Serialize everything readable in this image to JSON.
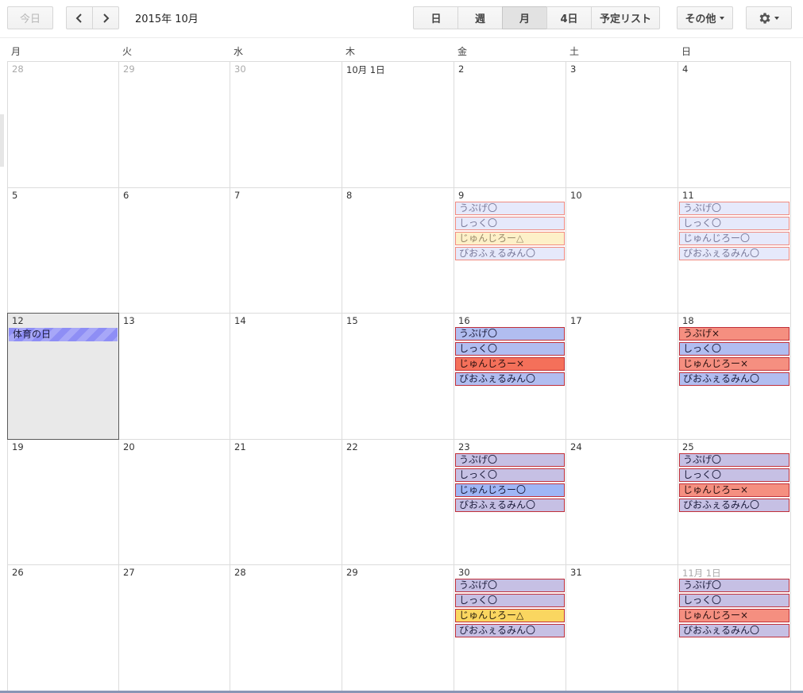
{
  "toolbar": {
    "today": "今日",
    "title": "2015年 10月",
    "views": [
      {
        "label": "日",
        "active": false
      },
      {
        "label": "週",
        "active": false
      },
      {
        "label": "月",
        "active": true
      },
      {
        "label": "4日",
        "active": false
      },
      {
        "label": "予定リスト",
        "active": false
      }
    ],
    "more": "その他"
  },
  "weekdays": [
    "月",
    "火",
    "水",
    "木",
    "金",
    "土",
    "日"
  ],
  "weeks": [
    [
      {
        "label": "28",
        "other": true,
        "events": []
      },
      {
        "label": "29",
        "other": true,
        "events": []
      },
      {
        "label": "30",
        "other": true,
        "events": []
      },
      {
        "label": "10月 1日",
        "other": false,
        "events": []
      },
      {
        "label": "2",
        "other": false,
        "events": []
      },
      {
        "label": "3",
        "other": false,
        "events": []
      },
      {
        "label": "4",
        "other": false,
        "events": []
      }
    ],
    [
      {
        "label": "5",
        "events": []
      },
      {
        "label": "6",
        "events": []
      },
      {
        "label": "7",
        "events": []
      },
      {
        "label": "8",
        "events": []
      },
      {
        "label": "9",
        "events": [
          {
            "title": "うぶげ〇",
            "style": "past"
          },
          {
            "title": "しっく〇",
            "style": "past"
          },
          {
            "title": "じゅんじろー△",
            "style": "past-yellow"
          },
          {
            "title": "びおふぇるみん〇",
            "style": "past"
          }
        ]
      },
      {
        "label": "10",
        "events": []
      },
      {
        "label": "11",
        "events": [
          {
            "title": "うぶげ〇",
            "style": "past"
          },
          {
            "title": "しっく〇",
            "style": "past"
          },
          {
            "title": "じゅんじろー〇",
            "style": "past"
          },
          {
            "title": "びおふぇるみん〇",
            "style": "past"
          }
        ]
      }
    ],
    [
      {
        "label": "12",
        "today": true,
        "allday": "体育の日",
        "events": []
      },
      {
        "label": "13",
        "events": []
      },
      {
        "label": "14",
        "events": []
      },
      {
        "label": "15",
        "events": []
      },
      {
        "label": "16",
        "events": [
          {
            "title": "うぶげ〇",
            "style": "blue"
          },
          {
            "title": "しっく〇",
            "style": "blue"
          },
          {
            "title": "じゅんじろー×",
            "style": "red-strong"
          },
          {
            "title": "びおふぇるみん〇",
            "style": "blue"
          }
        ]
      },
      {
        "label": "17",
        "events": []
      },
      {
        "label": "18",
        "events": [
          {
            "title": "うぶげ×",
            "style": "salmon"
          },
          {
            "title": "しっく〇",
            "style": "blue"
          },
          {
            "title": "じゅんじろー×",
            "style": "salmon"
          },
          {
            "title": "びおふぇるみん〇",
            "style": "blue"
          }
        ]
      }
    ],
    [
      {
        "label": "19",
        "events": []
      },
      {
        "label": "20",
        "events": []
      },
      {
        "label": "21",
        "events": []
      },
      {
        "label": "22",
        "events": []
      },
      {
        "label": "23",
        "events": [
          {
            "title": "うぶげ〇",
            "style": "lavender"
          },
          {
            "title": "しっく〇",
            "style": "lavender"
          },
          {
            "title": "じゅんじろー〇",
            "style": "cornflower"
          },
          {
            "title": "びおふぇるみん〇",
            "style": "lavender"
          }
        ]
      },
      {
        "label": "24",
        "events": []
      },
      {
        "label": "25",
        "events": [
          {
            "title": "うぶげ〇",
            "style": "lavender"
          },
          {
            "title": "しっく〇",
            "style": "lavender"
          },
          {
            "title": "じゅんじろー×",
            "style": "salmon"
          },
          {
            "title": "びおふぇるみん〇",
            "style": "lavender"
          }
        ]
      }
    ],
    [
      {
        "label": "26",
        "events": []
      },
      {
        "label": "27",
        "events": []
      },
      {
        "label": "28",
        "events": []
      },
      {
        "label": "29",
        "events": []
      },
      {
        "label": "30",
        "events": [
          {
            "title": "うぶげ〇",
            "style": "lavender"
          },
          {
            "title": "しっく〇",
            "style": "lavender"
          },
          {
            "title": "じゅんじろー△",
            "style": "yellow"
          },
          {
            "title": "びおふぇるみん〇",
            "style": "lavender"
          }
        ]
      },
      {
        "label": "31",
        "events": []
      },
      {
        "label": "11月 1日",
        "other": true,
        "events": [
          {
            "title": "うぶげ〇",
            "style": "lavender"
          },
          {
            "title": "しっく〇",
            "style": "lavender"
          },
          {
            "title": "じゅんじろー×",
            "style": "salmon"
          },
          {
            "title": "びおふぇるみん〇",
            "style": "lavender"
          }
        ]
      }
    ]
  ],
  "event_styles": {
    "past": {
      "bg": "#e6e9fb",
      "border": "#f08a80",
      "color": "#7a7a9a"
    },
    "past-yellow": {
      "bg": "#fdf0c8",
      "border": "#f08a80",
      "color": "#9a8a6a"
    },
    "blue": {
      "bg": "#b1bdf0",
      "border": "#c0303a",
      "color": "#1b1b3a"
    },
    "red-strong": {
      "bg": "#f4705a",
      "border": "#c0303a",
      "color": "#2a1010"
    },
    "salmon": {
      "bg": "#f58f80",
      "border": "#c0303a",
      "color": "#2a1010"
    },
    "lavender": {
      "bg": "#c6c0e4",
      "border": "#c0303a",
      "color": "#1b1b3a"
    },
    "cornflower": {
      "bg": "#9fb6f5",
      "border": "#c0303a",
      "color": "#1b1b3a"
    },
    "yellow": {
      "bg": "#fad660",
      "border": "#c0303a",
      "color": "#2a2010"
    }
  }
}
